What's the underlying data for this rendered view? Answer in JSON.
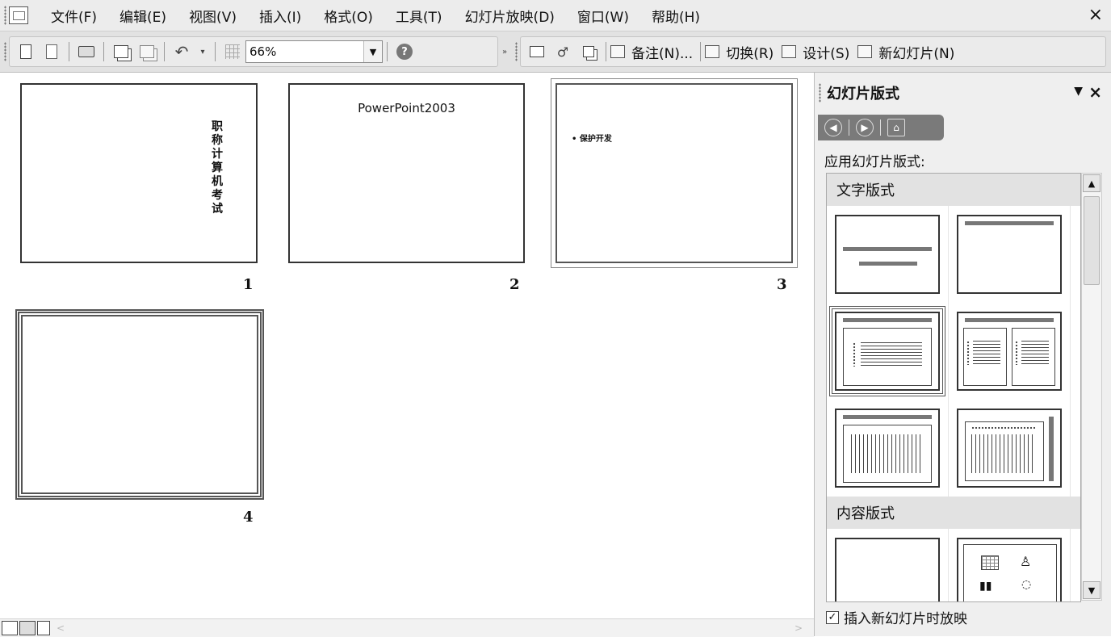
{
  "menu": {
    "items": [
      "文件(F)",
      "编辑(E)",
      "视图(V)",
      "插入(I)",
      "格式(O)",
      "工具(T)",
      "幻灯片放映(D)",
      "窗口(W)",
      "帮助(H)"
    ],
    "close": "×"
  },
  "toolbar": {
    "zoom_value": "66%",
    "notes_label": "备注(N)...",
    "transition_label": "切换(R)",
    "design_label": "设计(S)",
    "new_slide_label": "新幻灯片(N)"
  },
  "slides": [
    {
      "number": "1",
      "vertical_text": "职称计算机考试"
    },
    {
      "number": "2",
      "title": "PowerPoint2003"
    },
    {
      "number": "3",
      "bullet": "• 保护开发"
    },
    {
      "number": "4"
    }
  ],
  "taskpane": {
    "title": "幻灯片版式",
    "dropdown": "▼",
    "close": "×",
    "apply_label": "应用幻灯片版式:",
    "section_text": "文字版式",
    "section_content": "内容版式",
    "checkbox_label": "插入新幻灯片时放映",
    "checkbox_checked": true
  }
}
